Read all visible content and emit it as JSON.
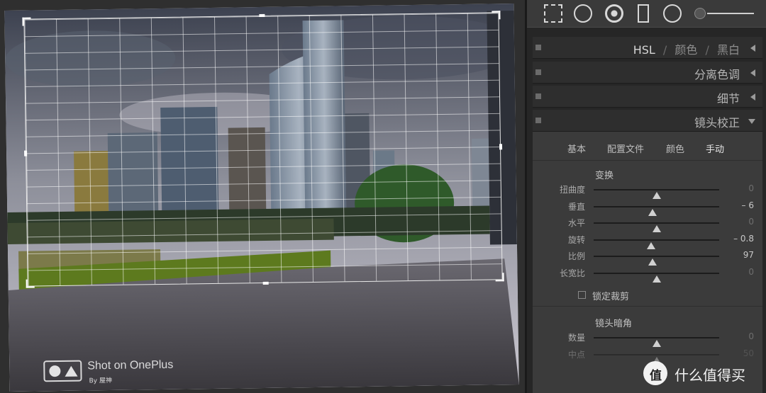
{
  "photo": {
    "watermark_main": "Shot on OnePlus",
    "watermark_sub": "By 屋神"
  },
  "panel": {
    "sections": [
      {
        "title_parts": [
          "HSL",
          "/",
          "颜色",
          "/",
          "黑白"
        ],
        "collapsed": true
      },
      {
        "title": "分离色调",
        "collapsed": true
      },
      {
        "title": "细节",
        "collapsed": true
      },
      {
        "title": "镜头校正",
        "collapsed": false
      }
    ],
    "lens": {
      "tabs": [
        "基本",
        "配置文件",
        "颜色",
        "手动"
      ],
      "active_tab": "手动",
      "transform_title": "变换",
      "sliders": [
        {
          "label": "扭曲度",
          "value": "0",
          "level": 0.5
        },
        {
          "label": "垂直",
          "value": "– 6",
          "level": 0.47
        },
        {
          "label": "水平",
          "value": "0",
          "level": 0.5
        },
        {
          "label": "旋转",
          "value": "– 0.8",
          "level": 0.46
        },
        {
          "label": "比例",
          "value": "97",
          "level": 0.47
        },
        {
          "label": "长宽比",
          "value": "0",
          "level": 0.5
        }
      ],
      "lock_crop_label": "锁定裁剪",
      "vignette_title": "镜头暗角",
      "vignette_sliders": [
        {
          "label": "数量",
          "value": "0",
          "level": 0.5
        },
        {
          "label": "中点",
          "value": "50",
          "level": 0.5
        }
      ]
    }
  },
  "brand": {
    "logo_char": "值",
    "name": "什么值得买"
  },
  "colors": {
    "panel_bg": "#262626",
    "body_bg": "#3b3b3b",
    "accent": "#d0d0d0"
  },
  "icons": [
    "crop-overlay-icon",
    "spot-removal-icon",
    "red-eye-icon",
    "graduated-filter-icon",
    "radial-filter-icon",
    "adjustment-brush-slider-icon"
  ]
}
